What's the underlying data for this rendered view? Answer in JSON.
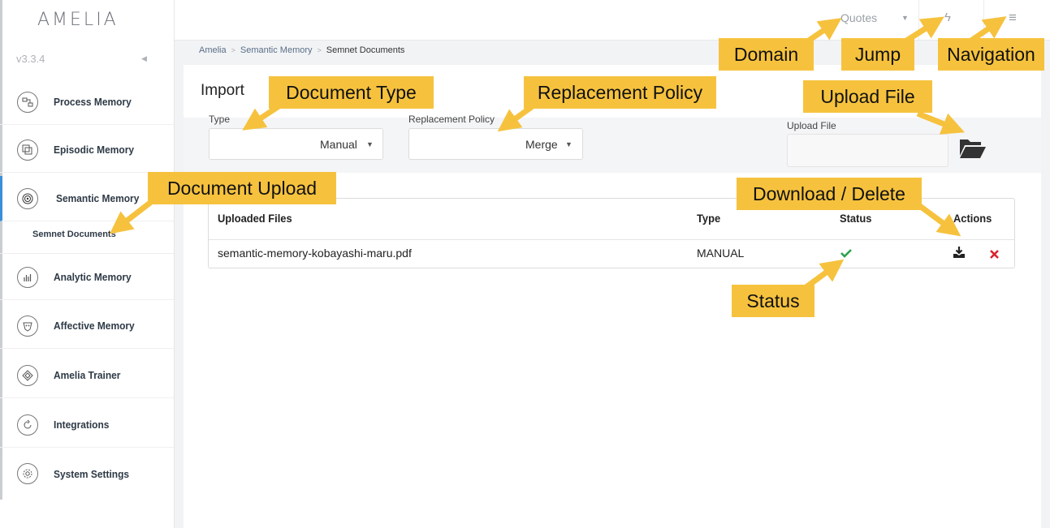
{
  "app": {
    "logo": "AMELIA",
    "version": "v3.3.4"
  },
  "sidebar": {
    "items": [
      {
        "label": "Process Memory",
        "icon": "process-memory-icon"
      },
      {
        "label": "Episodic Memory",
        "icon": "episodic-memory-icon"
      },
      {
        "label": "Semantic Memory",
        "icon": "semantic-memory-icon",
        "active": true
      },
      {
        "label": "Analytic Memory",
        "icon": "analytic-memory-icon"
      },
      {
        "label": "Affective Memory",
        "icon": "affective-memory-icon"
      },
      {
        "label": "Amelia Trainer",
        "icon": "amelia-trainer-icon"
      },
      {
        "label": "Integrations",
        "icon": "integrations-icon"
      },
      {
        "label": "System Settings",
        "icon": "system-settings-icon"
      }
    ],
    "sub_item": "Semnet Documents"
  },
  "topbar": {
    "domain": "Quotes",
    "jump_icon": "bolt-icon",
    "menu_icon": "hamburger-menu-icon"
  },
  "breadcrumb": [
    "Amelia",
    "Semantic Memory",
    "Semnet Documents"
  ],
  "import": {
    "title": "Import",
    "type_label": "Type",
    "type_value": "Manual",
    "policy_label": "Replacement Policy",
    "policy_value": "Merge",
    "upload_label": "Upload File",
    "upload_icon": "folder-open-icon"
  },
  "table": {
    "headers": [
      "Uploaded Files",
      "Type",
      "Status",
      "Actions"
    ],
    "rows": [
      {
        "file": "semantic-memory-kobayashi-maru.pdf",
        "type": "MANUAL",
        "status": "success",
        "actions": [
          "download-icon",
          "delete-icon"
        ]
      }
    ]
  },
  "callouts": {
    "domain": "Domain",
    "jump": "Jump",
    "navigation": "Navigation",
    "document_type": "Document Type",
    "replacement_policy": "Replacement Policy",
    "upload_file": "Upload File",
    "document_upload": "Document Upload",
    "download_delete": "Download / Delete",
    "status": "Status"
  },
  "colors": {
    "callout": "#f6c23e",
    "accent": "#3b8fd9",
    "success": "#2ca24a",
    "danger": "#d9242b"
  }
}
